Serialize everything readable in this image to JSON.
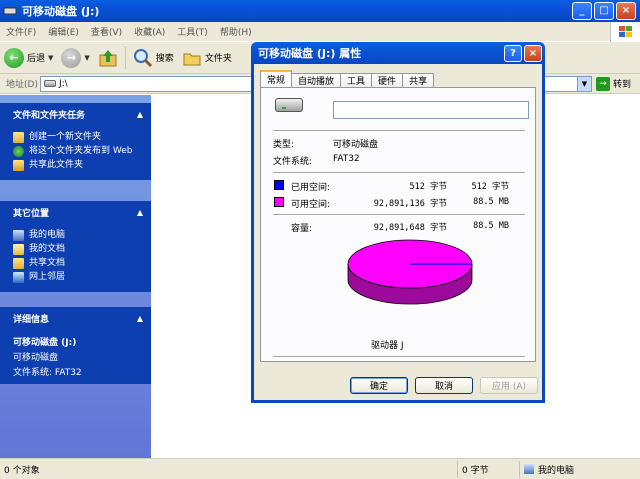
{
  "window": {
    "title": "可移动磁盘 (J:)",
    "minimize": "_",
    "maximize": "□",
    "close": "×"
  },
  "menubar": [
    "文件(F)",
    "编辑(E)",
    "查看(V)",
    "收藏(A)",
    "工具(T)",
    "帮助(H)"
  ],
  "toolbar": {
    "back_label": "后退",
    "search_label": "搜索",
    "folders_label": "文件夹"
  },
  "address": {
    "label": "地址(D)",
    "value": "J:\\",
    "go_label": "转到"
  },
  "taskpane": {
    "tasks": {
      "header": "文件和文件夹任务",
      "items": [
        "创建一个新文件夹",
        "将这个文件夹发布到 Web",
        "共享此文件夹"
      ]
    },
    "other": {
      "header": "其它位置",
      "items": [
        "我的电脑",
        "我的文档",
        "共享文档",
        "网上邻居"
      ]
    },
    "details": {
      "header": "详细信息",
      "name": "可移动磁盘 (J:)",
      "type": "可移动磁盘",
      "fs": "文件系统: FAT32"
    }
  },
  "statusbar": {
    "objects": "0 个对象",
    "size": "0 字节",
    "location": "我的电脑"
  },
  "dialog": {
    "title": "可移动磁盘 (J:) 属性",
    "help": "?",
    "close": "×",
    "tabs": [
      "常规",
      "自动播放",
      "工具",
      "硬件",
      "共享"
    ],
    "name_value": "",
    "type_label": "类型:",
    "type_value": "可移动磁盘",
    "fs_label": "文件系统:",
    "fs_value": "FAT32",
    "used": {
      "label": "已用空间:",
      "bytes": "512 字节",
      "human": "512 字节",
      "color": "#0000ff"
    },
    "free": {
      "label": "可用空间:",
      "bytes": "92,891,136 字节",
      "human": "88.5 MB",
      "color": "#ff00ff"
    },
    "capacity": {
      "label": "容量:",
      "bytes": "92,891,648 字节",
      "human": "88.5 MB"
    },
    "drive_label": "驱动器 J",
    "used_fraction": 5.5e-06,
    "buttons": {
      "ok": "确定",
      "cancel": "取消",
      "apply": "应用 (A)"
    }
  }
}
